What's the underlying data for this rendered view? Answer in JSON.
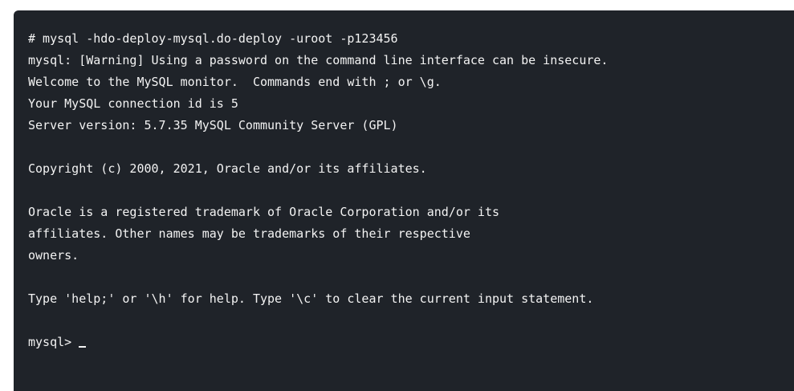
{
  "terminal": {
    "background": "#1f2329",
    "text_color": "#f3f3f3",
    "lines": [
      "# mysql -hdo-deploy-mysql.do-deploy -uroot -p123456",
      "mysql: [Warning] Using a password on the command line interface can be insecure.",
      "Welcome to the MySQL monitor.  Commands end with ; or \\g.",
      "Your MySQL connection id is 5",
      "Server version: 5.7.35 MySQL Community Server (GPL)",
      "",
      "Copyright (c) 2000, 2021, Oracle and/or its affiliates.",
      "",
      "Oracle is a registered trademark of Oracle Corporation and/or its",
      "affiliates. Other names may be trademarks of their respective",
      "owners.",
      "",
      "Type 'help;' or '\\h' for help. Type '\\c' to clear the current input statement.",
      ""
    ],
    "prompt": "mysql>"
  }
}
